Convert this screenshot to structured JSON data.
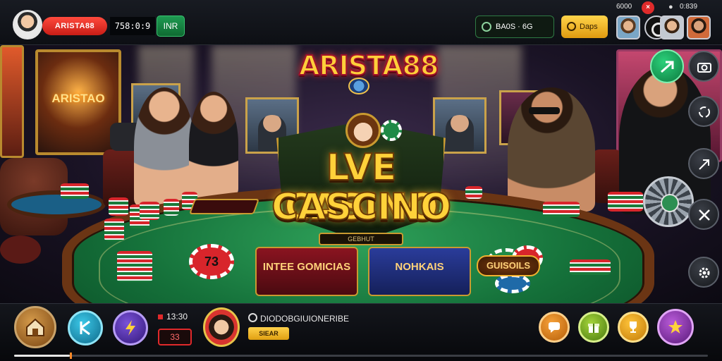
{
  "top_bar": {
    "player_name": "ARISTA88",
    "balance": "758:0:9",
    "currency_button": "INR",
    "green_pill_label": "BA0S · 6G",
    "gold_pill_label": "Daps",
    "status_text": "6000",
    "status_badge": "×",
    "status_time": "0:839"
  },
  "scene": {
    "header_logo": "ARISTA88",
    "poster_left_label": "ARISTAO",
    "main_title_line1": "LVE CASINO",
    "main_title_line2": "CASCINO",
    "main_title_sub": "GEBHUT",
    "tile_left": "INTEE GOMICIAS",
    "tile_middle": "NOHKAIS",
    "tile_right": "GUISOILS",
    "chip_label": "73"
  },
  "bottom_bar": {
    "timer": "13:30",
    "red_box": "33",
    "username": "DIODOBGIUIONERIBE",
    "gold_button": "SIEAR"
  },
  "progress": {
    "value_fraction": 0.08
  },
  "colors": {
    "accent_red": "#e0292b",
    "accent_gold": "#ffd23a",
    "table_green": "#15713a"
  },
  "icons": [
    "avatar-icon",
    "network-icon",
    "coin-icon",
    "camera-icon",
    "recycle-icon",
    "share-icon",
    "tools-icon",
    "gear-icon",
    "home-icon",
    "k-icon",
    "lightning-icon",
    "chat-icon",
    "gift-icon",
    "trophy-icon",
    "star-icon"
  ]
}
